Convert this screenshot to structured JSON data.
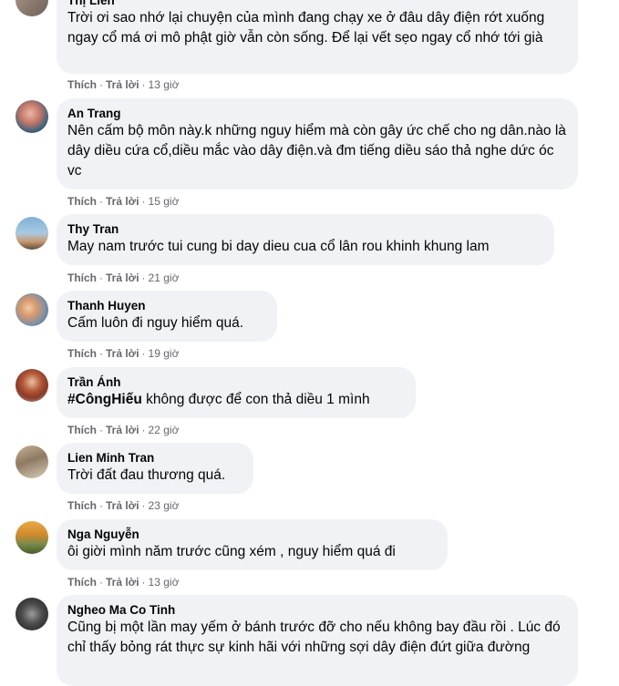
{
  "comments": [
    {
      "author": "Thị Liên",
      "text": "Trời ơi sao nhớ lại chuyện của mình đang chạy xe ở đâu dây điện rớt xuống ngay cổ má ơi mô phật giờ vẫn còn sống. Để lại vết sẹo ngay cổ nhớ tới già",
      "like": "Thích",
      "reply": "Trả lời",
      "time": "13 giờ"
    },
    {
      "author": "An Trang",
      "text": "Nên cấm bộ môn này.k những nguy hiểm mà còn gây ức chế cho ng dân.nào là dây diều cứa cổ,diều mắc vào dây điện.và đm tiếng diều sáo thả nghe dức óc vc",
      "like": "Thích",
      "reply": "Trả lời",
      "time": "15 giờ"
    },
    {
      "author": "Thy Tran",
      "text": "May nam trước tui cung bi day dieu cua cổ lân rou khinh khung lam",
      "like": "Thích",
      "reply": "Trả lời",
      "time": "21 giờ"
    },
    {
      "author": "Thanh Huyen",
      "text": "Cấm luôn đi nguy hiểm quá.",
      "like": "Thích",
      "reply": "Trả lời",
      "time": "19 giờ"
    },
    {
      "author": "Trần Ánh",
      "tag": "#CôngHiếu",
      "text": " không được để con thả diều 1 mình",
      "like": "Thích",
      "reply": "Trả lời",
      "time": "22 giờ"
    },
    {
      "author": "Lien Minh Tran",
      "text": "Trời đất đau thương quá.",
      "like": "Thích",
      "reply": "Trả lời",
      "time": "23 giờ"
    },
    {
      "author": "Nga Nguyễn",
      "text": "ôi giời mình năm trước cũng xém , nguy hiểm quá đi",
      "like": "Thích",
      "reply": "Trả lời",
      "time": "13 giờ"
    },
    {
      "author": "Ngheo Ma Co Tinh",
      "text": "Cũng bị một lần may yếm ở bánh trước đỡ cho nếu không bay đầu rồi . Lúc đó chỉ thấy bỏng rát thực sự kinh hãi với những sợi dây điện đứt giữa đường"
    }
  ],
  "colors": {
    "bubble": "#f0f2f5",
    "meta": "#65676b",
    "text": "#050505"
  }
}
